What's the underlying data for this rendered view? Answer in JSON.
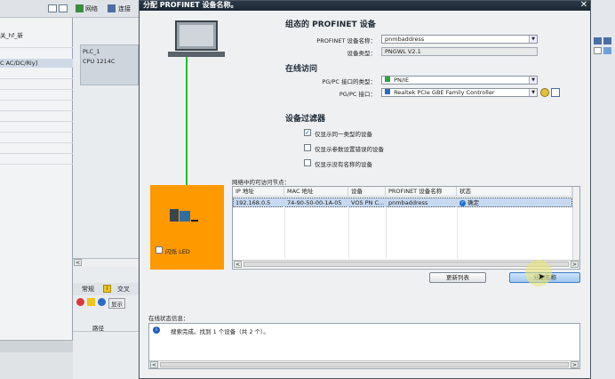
{
  "background": {
    "toolbar": {
      "network_label": "网络",
      "connect_label": "连接"
    },
    "left_panel_text_1": "关_hf_新",
    "left_panel_text_2": "C AC/DC/Rly]",
    "device": {
      "name": "PLC_1",
      "cpu": "CPU 1214C"
    },
    "bottom_tabs": {
      "general": "常规",
      "cross_ref": "交叉"
    },
    "bottom_show_label": "显示",
    "path_label": "路径"
  },
  "dialog": {
    "title": "分配 PROFINET 设备名称。",
    "configured_section": {
      "title": "组态的 PROFINET 设备",
      "device_name_label": "PROFINET 设备名称：",
      "device_name_value": "pnmbaddress",
      "device_type_label": "设备类型：",
      "device_type_value": "PNGWL V2.1"
    },
    "online_section": {
      "title": "在线访问",
      "interface_type_label": "PG/PC 接口的类型：",
      "interface_type_value": "PN/IE",
      "interface_label": "PG/PC 接口：",
      "interface_value": "Realtek PCIe GBE Family Controller"
    },
    "filter_section": {
      "title": "设备过滤器",
      "options": [
        {
          "label": "仅显示同一类型的设备",
          "checked": true
        },
        {
          "label": "仅显示参数设置错误的设备",
          "checked": false
        },
        {
          "label": "仅显示没有名称的设备",
          "checked": false
        }
      ]
    },
    "nodes_label": "网络中的可访问节点：",
    "table": {
      "columns": [
        "IP 地址",
        "MAC 地址",
        "设备",
        "PROFINET 设备名称",
        "状态"
      ],
      "rows": [
        {
          "ip": "192.168.0.5",
          "mac": "74-90-50-00-1A-05",
          "device": "VOS PN C...",
          "name": "pnmbaddress",
          "status": "确定"
        }
      ]
    },
    "flash_led_label": "闪烁 LED",
    "update_list_button": "更新列表",
    "assign_name_button": "分配名称",
    "status_info_label": "在线状态信息：",
    "status_message": "搜索完成。找到 1 个设备（共 2 个）。"
  },
  "colors": {
    "orange_panel": "#ff9900",
    "link_line": "#22c02a",
    "selected_row": "#c6d9f1"
  }
}
